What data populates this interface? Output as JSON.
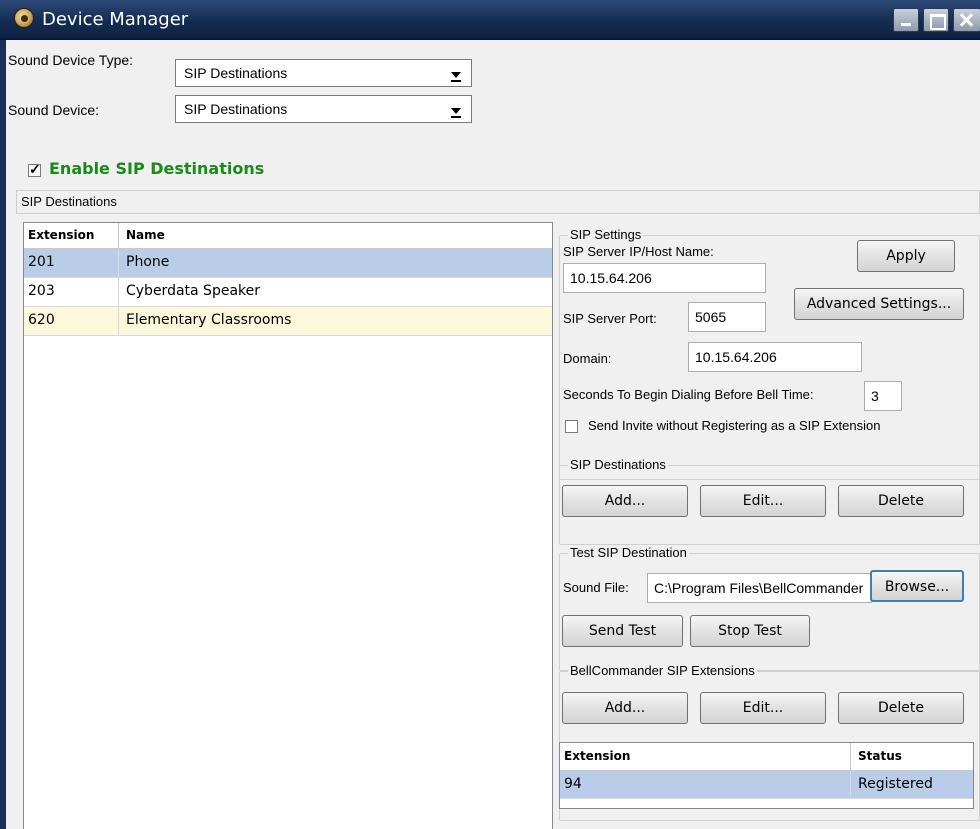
{
  "window": {
    "title": "Device Manager"
  },
  "device_type": {
    "label": "Sound Device Type:",
    "value": "SIP Destinations"
  },
  "sound_device": {
    "label": "Sound Device:",
    "value": "SIP Destinations"
  },
  "enable_sip": {
    "label": "Enable SIP Destinations",
    "checked": true
  },
  "destinations_header": "SIP Destinations",
  "destinations_list": {
    "columns": [
      "Extension",
      "Name"
    ],
    "rows": [
      {
        "extension": "201",
        "name": "Phone",
        "state": "selected"
      },
      {
        "extension": "203",
        "name": "Cyberdata Speaker",
        "state": "normal"
      },
      {
        "extension": "620",
        "name": "Elementary Classrooms",
        "state": "highlight"
      }
    ]
  },
  "sip_settings": {
    "title": "SIP Settings",
    "server_label": "SIP Server IP/Host Name:",
    "server_value": "10.15.64.206",
    "apply_label": "Apply",
    "advanced_label": "Advanced Settings...",
    "port_label": "SIP Server Port:",
    "port_value": "5065",
    "domain_label": "Domain:",
    "domain_value": "10.15.64.206",
    "seconds_label": "Seconds To Begin Dialing Before Bell Time:",
    "seconds_value": "3",
    "send_invite_label": "Send Invite without Registering as a SIP Extension",
    "send_invite_checked": false
  },
  "sip_destinations_group": {
    "title": "SIP Destinations",
    "add_label": "Add...",
    "edit_label": "Edit...",
    "delete_label": "Delete"
  },
  "test_group": {
    "title": "Test SIP Destination",
    "sound_file_label": "Sound File:",
    "sound_file_value": "C:\\Program Files\\BellCommander",
    "browse_label": "Browse...",
    "send_test_label": "Send Test",
    "stop_test_label": "Stop Test"
  },
  "extensions_group": {
    "title": "BellCommander SIP Extensions",
    "add_label": "Add...",
    "edit_label": "Edit...",
    "delete_label": "Delete",
    "columns": [
      "Extension",
      "Status"
    ],
    "rows": [
      {
        "extension": "94",
        "status": "Registered"
      }
    ]
  },
  "colors": {
    "selected_row": "#b9cde8",
    "highlight_row": "#fbf8dc",
    "enable_label": "#1a8a1a",
    "title_bar": "#142c52"
  }
}
